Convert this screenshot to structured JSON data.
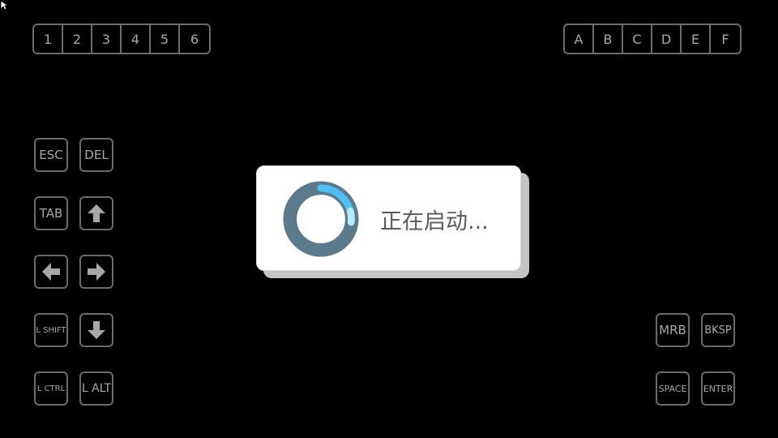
{
  "number_strip": [
    "1",
    "2",
    "3",
    "4",
    "5",
    "6"
  ],
  "letter_strip": [
    "A",
    "B",
    "C",
    "D",
    "E",
    "F"
  ],
  "keys": {
    "esc": "ESC",
    "del": "DEL",
    "tab": "TAB",
    "lshift": "L SHIFT",
    "lctrl": "L CTRL",
    "lalt": "L ALT",
    "mrb": "MRB",
    "bksp": "BKSP",
    "space": "SPACE",
    "enter": "ENTER"
  },
  "icons": {
    "up": "arrow-up-icon",
    "left": "arrow-left-icon",
    "right": "arrow-right-icon",
    "down": "arrow-down-icon",
    "spinner": "loading-spinner-icon",
    "cursor": "mouse-cursor-icon"
  },
  "dialog": {
    "message": "正在启动..."
  },
  "colors": {
    "background": "#000000",
    "key_border": "#6b6b6b",
    "key_text": "#a8a8a8",
    "spinner_ring": "#5b7a8c",
    "spinner_arc": "#4fc3f7",
    "dialog_bg": "#ffffff"
  }
}
